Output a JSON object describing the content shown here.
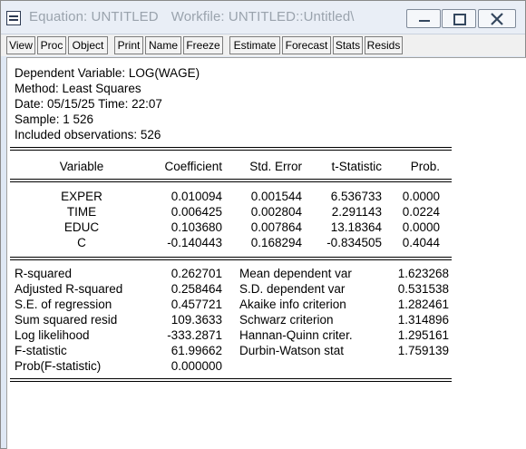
{
  "window": {
    "title_main": "Equation: UNTITLED",
    "title_workfile": "Workfile: UNTITLED::Untitled\\"
  },
  "toolbar": [
    "View",
    "Proc",
    "Object",
    "Print",
    "Name",
    "Freeze",
    "Estimate",
    "Forecast",
    "Stats",
    "Resids"
  ],
  "header": {
    "dependent": "Dependent Variable: LOG(WAGE)",
    "method": "Method: Least Squares",
    "date": "Date: 05/15/25   Time: 22:07",
    "sample": "Sample: 1 526",
    "obs": "Included observations: 526"
  },
  "coef_table": {
    "columns": [
      "Variable",
      "Coefficient",
      "Std. Error",
      "t-Statistic",
      "Prob."
    ],
    "rows": [
      {
        "variable": "EXPER",
        "coefficient": "0.010094",
        "std_error": "0.001544",
        "t_statistic": "6.536733",
        "prob": "0.0000"
      },
      {
        "variable": "TIME",
        "coefficient": "0.006425",
        "std_error": "0.002804",
        "t_statistic": "2.291143",
        "prob": "0.0224"
      },
      {
        "variable": "EDUC",
        "coefficient": "0.103680",
        "std_error": "0.007864",
        "t_statistic": "13.18364",
        "prob": "0.0000"
      },
      {
        "variable": "C",
        "coefficient": "-0.140443",
        "std_error": "0.168294",
        "t_statistic": "-0.834505",
        "prob": "0.4044"
      }
    ]
  },
  "stats": {
    "left": [
      {
        "label": "R-squared",
        "value": "0.262701"
      },
      {
        "label": "Adjusted R-squared",
        "value": "0.258464"
      },
      {
        "label": "S.E. of regression",
        "value": "0.457721"
      },
      {
        "label": "Sum squared resid",
        "value": "109.3633"
      },
      {
        "label": "Log likelihood",
        "value": "-333.2871"
      },
      {
        "label": "F-statistic",
        "value": "61.99662"
      },
      {
        "label": "Prob(F-statistic)",
        "value": "0.000000"
      }
    ],
    "right": [
      {
        "label": "Mean dependent var",
        "value": "1.623268"
      },
      {
        "label": "S.D. dependent var",
        "value": "0.531538"
      },
      {
        "label": "Akaike info criterion",
        "value": "1.282461"
      },
      {
        "label": "Schwarz criterion",
        "value": "1.314896"
      },
      {
        "label": "Hannan-Quinn criter.",
        "value": "1.295161"
      },
      {
        "label": "Durbin-Watson stat",
        "value": "1.759139"
      }
    ]
  }
}
